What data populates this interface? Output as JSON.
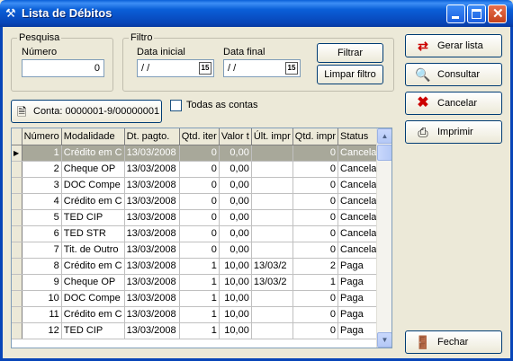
{
  "window": {
    "title": "Lista de Débitos",
    "icon": "wrench-icon"
  },
  "pesquisa": {
    "group_label": "Pesquisa",
    "numero_label": "Número",
    "numero_value": "0"
  },
  "filtro": {
    "group_label": "Filtro",
    "data_inicial_label": "Data inicial",
    "data_inicial_value": "/ /",
    "data_final_label": "Data final",
    "data_final_value": "/ /",
    "filtrar_label": "Filtrar",
    "limpar_label": "Limpar filtro"
  },
  "conta": {
    "button_label": "Conta: 0000001-9/00000001",
    "todas_label": "Todas as contas",
    "todas_checked": false
  },
  "grid": {
    "columns": [
      "Número",
      "Modalidade",
      "Dt. pagto.",
      "Qtd. iter",
      "Valor t",
      "Últ. impr",
      "Qtd. impr",
      "Status"
    ],
    "rows": [
      [
        "1",
        "Crédito em C",
        "13/03/2008",
        "0",
        "0,00",
        "",
        "0",
        "Cancelada"
      ],
      [
        "2",
        "Cheque OP",
        "13/03/2008",
        "0",
        "0,00",
        "",
        "0",
        "Cancelada"
      ],
      [
        "3",
        "DOC Compe",
        "13/03/2008",
        "0",
        "0,00",
        "",
        "0",
        "Cancelada"
      ],
      [
        "4",
        "Crédito em C",
        "13/03/2008",
        "0",
        "0,00",
        "",
        "0",
        "Cancelada"
      ],
      [
        "5",
        "TED CIP",
        "13/03/2008",
        "0",
        "0,00",
        "",
        "0",
        "Cancelada"
      ],
      [
        "6",
        "TED STR",
        "13/03/2008",
        "0",
        "0,00",
        "",
        "0",
        "Cancelada"
      ],
      [
        "7",
        "Tit. de Outro",
        "13/03/2008",
        "0",
        "0,00",
        "",
        "0",
        "Cancelada"
      ],
      [
        "8",
        "Crédito em C",
        "13/03/2008",
        "1",
        "10,00",
        "13/03/2",
        "2",
        "Paga"
      ],
      [
        "9",
        "Cheque OP",
        "13/03/2008",
        "1",
        "10,00",
        "13/03/2",
        "1",
        "Paga"
      ],
      [
        "10",
        "DOC Compe",
        "13/03/2008",
        "1",
        "10,00",
        "",
        "0",
        "Paga"
      ],
      [
        "11",
        "Crédito em C",
        "13/03/2008",
        "1",
        "10,00",
        "",
        "0",
        "Paga"
      ],
      [
        "12",
        "TED CIP",
        "13/03/2008",
        "1",
        "10,00",
        "",
        "0",
        "Paga"
      ]
    ],
    "selected_row": 0
  },
  "actions": {
    "gerar": "Gerar lista",
    "consultar": "Consultar",
    "cancelar": "Cancelar",
    "imprimir": "Imprimir",
    "fechar": "Fechar"
  }
}
